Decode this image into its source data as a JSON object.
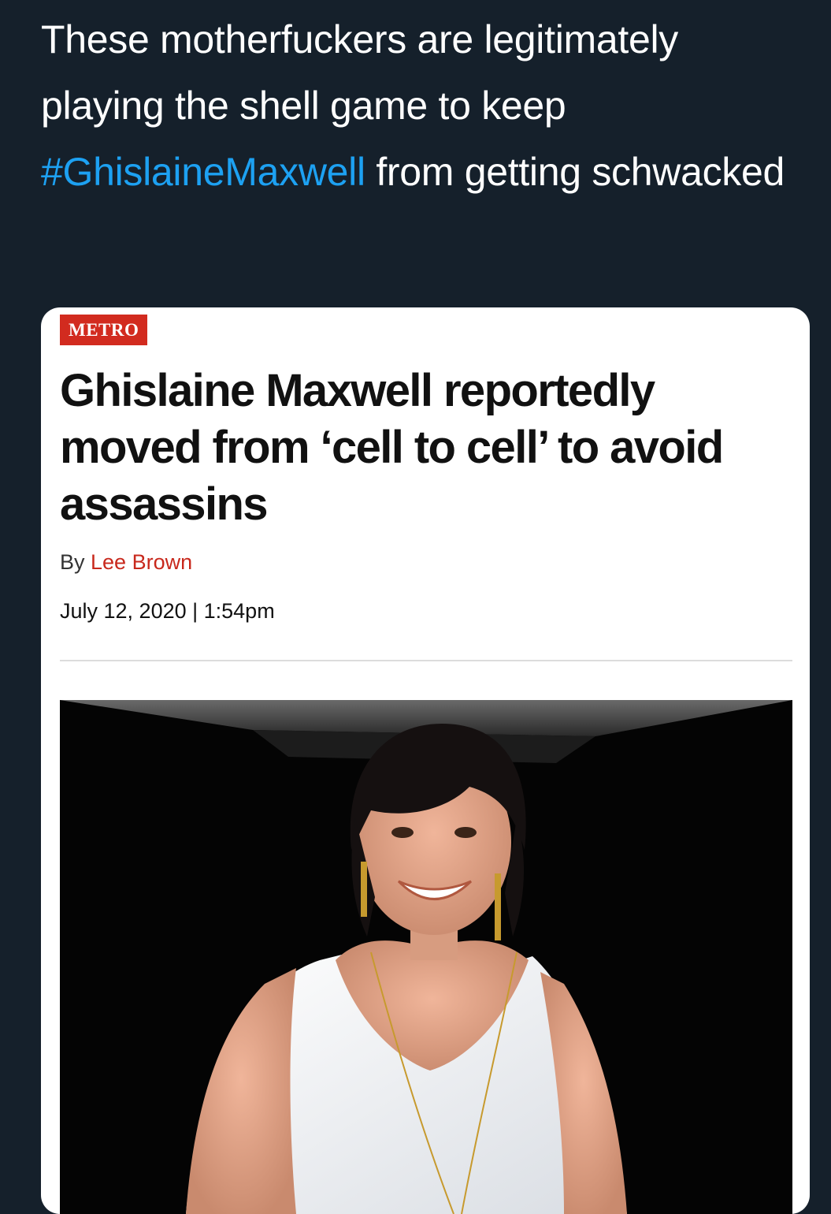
{
  "tweet": {
    "text_before": "These motherfuckers are legitimately playing the shell game to keep ",
    "hashtag": "#GhislaineMaxwell",
    "text_after": " from getting schwacked"
  },
  "article": {
    "section": "METRO",
    "headline": "Ghislaine Maxwell reportedly moved from ‘cell to cell’ to avoid assassins",
    "byline_prefix": "By ",
    "author": "Lee Brown",
    "date": "July 12, 2020 | 1:54pm"
  },
  "colors": {
    "background": "#15202b",
    "hashtag": "#1da1f2",
    "section_badge": "#d22b1f",
    "author": "#c8281c"
  }
}
